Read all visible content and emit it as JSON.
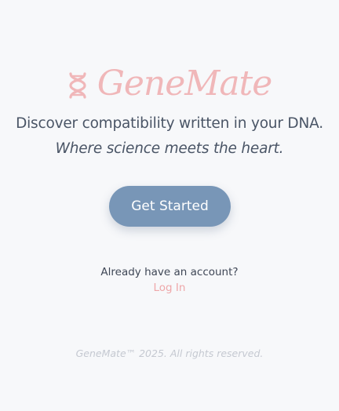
{
  "brand": {
    "name": "GeneMate",
    "icon": "dna-icon",
    "color": "#f0b7b9"
  },
  "hero": {
    "tagline": "Discover compatibility written in your DNA.",
    "subtagline": "Where science meets the heart."
  },
  "cta": {
    "label": "Get Started",
    "color": "#7896b7"
  },
  "account": {
    "prompt": "Already have an account?",
    "login_label": "Log In",
    "login_color": "#eea7a9"
  },
  "footer": {
    "text": "GeneMate™ 2025. All rights reserved."
  }
}
